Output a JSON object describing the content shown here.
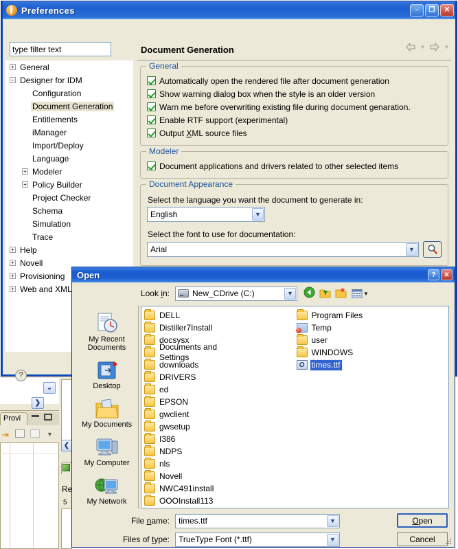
{
  "preferences": {
    "title": "Preferences",
    "icon": "novell-designer-icon",
    "window_buttons": {
      "minimize": "–",
      "maximize": "❐",
      "close": "✕"
    },
    "filter": {
      "placeholder": "type filter text",
      "value": "type filter text"
    },
    "help_icon": "?",
    "tree": [
      {
        "label": "General",
        "level": 0,
        "expander": "+",
        "selected": false
      },
      {
        "label": "Designer for IDM",
        "level": 0,
        "expander": "–",
        "selected": false
      },
      {
        "label": "Configuration",
        "level": 1,
        "expander": "",
        "selected": false
      },
      {
        "label": "Document Generation",
        "level": 1,
        "expander": "",
        "selected": true
      },
      {
        "label": "Entitlements",
        "level": 1,
        "expander": "",
        "selected": false
      },
      {
        "label": "iManager",
        "level": 1,
        "expander": "",
        "selected": false
      },
      {
        "label": "Import/Deploy",
        "level": 1,
        "expander": "",
        "selected": false
      },
      {
        "label": "Language",
        "level": 1,
        "expander": "",
        "selected": false
      },
      {
        "label": "Modeler",
        "level": 1,
        "expander": "+",
        "selected": false
      },
      {
        "label": "Policy Builder",
        "level": 1,
        "expander": "+",
        "selected": false
      },
      {
        "label": "Project Checker",
        "level": 1,
        "expander": "",
        "selected": false
      },
      {
        "label": "Schema",
        "level": 1,
        "expander": "",
        "selected": false
      },
      {
        "label": "Simulation",
        "level": 1,
        "expander": "",
        "selected": false
      },
      {
        "label": "Trace",
        "level": 1,
        "expander": "",
        "selected": false
      },
      {
        "label": "Help",
        "level": 0,
        "expander": "+",
        "selected": false
      },
      {
        "label": "Novell",
        "level": 0,
        "expander": "+",
        "selected": false
      },
      {
        "label": "Provisioning",
        "level": 0,
        "expander": "+",
        "selected": false
      },
      {
        "label": "Web and XML",
        "level": 0,
        "expander": "+",
        "selected": false
      }
    ],
    "page": {
      "title": "Document Generation",
      "nav": {
        "back_icon": "back-arrow-icon",
        "forward_icon": "forward-arrow-icon"
      },
      "groups": {
        "general": {
          "legend": "General",
          "checkboxes": [
            {
              "label": "Automatically open the rendered file after document generation",
              "checked": true
            },
            {
              "label": "Show warning dialog box when the style is an older version",
              "checked": true
            },
            {
              "label": "Warn me before overwriting existing file during document genaration.",
              "checked": true
            },
            {
              "label": "Enable RTF support (experimental)",
              "checked": true
            },
            {
              "label": "Output XML source files",
              "checked": true,
              "mnemonic": "X"
            }
          ]
        },
        "modeler": {
          "legend": "Modeler",
          "checkboxes": [
            {
              "label": "Document applications and drivers related to other selected items",
              "checked": true
            }
          ]
        },
        "appearance": {
          "legend": "Document Appearance",
          "language_label": "Select the language you want the document to generate in:",
          "language_value": "English",
          "font_label": "Select the font to use for documentation:",
          "font_value": "Arial",
          "browse_icon": "magnifier-icon"
        }
      }
    }
  },
  "open_dialog": {
    "title": "Open",
    "window_buttons": {
      "help": "?",
      "close": "✕"
    },
    "lookin": {
      "label": "Look in:",
      "value": "New_CDrive (C:)",
      "drive_icon": "hard-drive-icon",
      "tools": [
        "back-icon",
        "up-one-level-icon",
        "new-folder-icon",
        "views-icon"
      ]
    },
    "places": [
      {
        "label": "My Recent Documents",
        "icon": "recent-documents-icon"
      },
      {
        "label": "Desktop",
        "icon": "desktop-icon"
      },
      {
        "label": "My Documents",
        "icon": "my-documents-icon"
      },
      {
        "label": "My Computer",
        "icon": "my-computer-icon"
      },
      {
        "label": "My Network",
        "icon": "my-network-icon"
      }
    ],
    "files": [
      {
        "name": "DELL",
        "type": "folder",
        "selected": false
      },
      {
        "name": "Distiller7Install",
        "type": "folder",
        "selected": false
      },
      {
        "name": "docsysx",
        "type": "folder",
        "selected": false
      },
      {
        "name": "Documents and Settings",
        "type": "folder",
        "selected": false
      },
      {
        "name": "downloads",
        "type": "folder",
        "selected": false
      },
      {
        "name": "DRIVERS",
        "type": "folder",
        "selected": false
      },
      {
        "name": "ed",
        "type": "folder",
        "selected": false
      },
      {
        "name": "EPSON",
        "type": "folder",
        "selected": false
      },
      {
        "name": "gwclient",
        "type": "folder",
        "selected": false
      },
      {
        "name": "gwsetup",
        "type": "folder",
        "selected": false
      },
      {
        "name": "I386",
        "type": "folder",
        "selected": false
      },
      {
        "name": "NDPS",
        "type": "folder",
        "selected": false
      },
      {
        "name": "nls",
        "type": "folder",
        "selected": false
      },
      {
        "name": "Novell",
        "type": "folder",
        "selected": false
      },
      {
        "name": "NWC491install",
        "type": "folder",
        "selected": false
      },
      {
        "name": "OOOInstall113",
        "type": "folder",
        "selected": false
      },
      {
        "name": "Program Files",
        "type": "folder",
        "selected": false
      },
      {
        "name": "Temp",
        "type": "folder-shortcut",
        "selected": false
      },
      {
        "name": "user",
        "type": "folder",
        "selected": false
      },
      {
        "name": "WINDOWS",
        "type": "folder",
        "selected": false
      },
      {
        "name": "times.ttf",
        "type": "ttf",
        "selected": true
      }
    ],
    "filename": {
      "label": "File name:",
      "mnemonic": "n",
      "value": "times.ttf"
    },
    "filetype": {
      "label": "Files of type:",
      "mnemonic": "t",
      "value": "TrueType Font (*.ttf)"
    },
    "buttons": {
      "open": "Open",
      "cancel": "Cancel"
    }
  },
  "workbench": {
    "view_tab_label": "Provi",
    "editor_label": "Re"
  },
  "colors": {
    "title_blue": "#1d5fd0",
    "dialog_face": "#ece9d8",
    "legend_blue": "#20559c",
    "selection_blue": "#3163ce",
    "tree_selection": "#e8e4d0"
  }
}
